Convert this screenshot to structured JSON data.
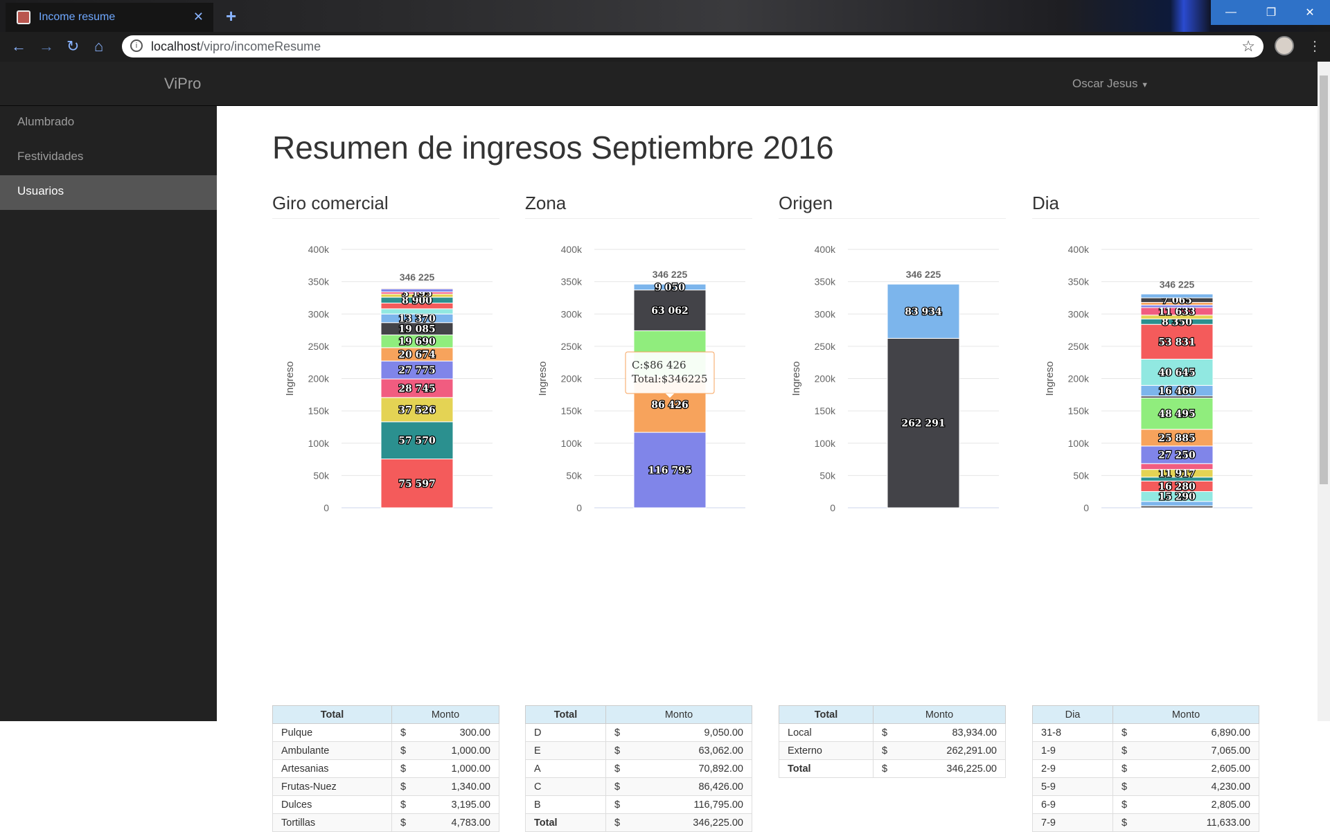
{
  "browser": {
    "tab_title": "Income resume",
    "url_host": "localhost",
    "url_path": "/vipro/incomeResume"
  },
  "app": {
    "brand": "ViPro",
    "user": "Oscar Jesus"
  },
  "sidebar": {
    "items": [
      {
        "label": "Alumbrado"
      },
      {
        "label": "Festividades"
      },
      {
        "label": "Usuarios"
      }
    ]
  },
  "page": {
    "title": "Resumen de ingresos Septiembre 2016"
  },
  "tooltip": {
    "line1": "C:$86 426",
    "line2": "Total:$346225"
  },
  "chart_data": [
    {
      "type": "bar",
      "stacked": true,
      "title": "Giro comercial",
      "ylabel": "Ingreso",
      "ylim": [
        0,
        400000
      ],
      "ticks": [
        "0",
        "50k",
        "100k",
        "150k",
        "200k",
        "250k",
        "300k",
        "350k",
        "400k"
      ],
      "total_label": "346 225",
      "segments": [
        {
          "value": 75597,
          "label": "75 597",
          "color": "#f45b5b"
        },
        {
          "value": 57570,
          "label": "57 570",
          "color": "#2b908f"
        },
        {
          "value": 37526,
          "label": "37 526",
          "color": "#e4d354"
        },
        {
          "value": 28745,
          "label": "28 745",
          "color": "#f15c80"
        },
        {
          "value": 27775,
          "label": "27 775",
          "color": "#8085e9"
        },
        {
          "value": 20674,
          "label": "20 674",
          "color": "#f7a35c"
        },
        {
          "value": 19690,
          "label": "19 690",
          "color": "#90ed7d"
        },
        {
          "value": 19085,
          "label": "19 085",
          "color": "#434348"
        },
        {
          "value": 13370,
          "label": "13 370",
          "color": "#7cb5ec"
        },
        {
          "value": 8000,
          "label": "",
          "color": "#91e8e1"
        },
        {
          "value": 8900,
          "label": "",
          "color": "#f45b5b"
        },
        {
          "value": 9000,
          "label": "8 900",
          "color": "#2b908f"
        },
        {
          "value": 5000,
          "label": "",
          "color": "#e4d354"
        },
        {
          "value": 3195,
          "label": "3 195",
          "color": "#f15c80"
        },
        {
          "value": 4783,
          "label": "",
          "color": "#8085e9"
        },
        {
          "value": 1340,
          "label": "",
          "color": "#f7a35c"
        },
        {
          "value": 1000,
          "label": "",
          "color": "#434348"
        },
        {
          "value": 1000,
          "label": "",
          "color": "#7cb5ec"
        }
      ]
    },
    {
      "type": "bar",
      "stacked": true,
      "title": "Zona",
      "ylabel": "Ingreso",
      "ylim": [
        0,
        400000
      ],
      "ticks": [
        "0",
        "50k",
        "100k",
        "150k",
        "200k",
        "250k",
        "300k",
        "350k",
        "400k"
      ],
      "total_label": "346 225",
      "segments": [
        {
          "value": 116795,
          "label": "116 795",
          "color": "#8085e9"
        },
        {
          "value": 86426,
          "label": "86 426",
          "color": "#f7a35c"
        },
        {
          "value": 70892,
          "label": "",
          "color": "#90ed7d"
        },
        {
          "value": 63062,
          "label": "63 062",
          "color": "#434348"
        },
        {
          "value": 9050,
          "label": "9 050",
          "color": "#7cb5ec"
        }
      ]
    },
    {
      "type": "bar",
      "stacked": true,
      "title": "Origen",
      "ylabel": "Ingreso",
      "ylim": [
        0,
        400000
      ],
      "ticks": [
        "0",
        "50k",
        "100k",
        "150k",
        "200k",
        "250k",
        "300k",
        "350k",
        "400k"
      ],
      "total_label": "346 225",
      "segments": [
        {
          "value": 262291,
          "label": "262 291",
          "color": "#434348"
        },
        {
          "value": 83934,
          "label": "83 934",
          "color": "#7cb5ec"
        }
      ]
    },
    {
      "type": "bar",
      "stacked": true,
      "title": "Dia",
      "ylabel": "Ingreso",
      "ylim": [
        0,
        400000
      ],
      "ticks": [
        "0",
        "50k",
        "100k",
        "150k",
        "200k",
        "250k",
        "300k",
        "350k",
        "400k"
      ],
      "total_label": "346 225",
      "segments": [
        {
          "value": 3000,
          "label": "",
          "color": "#434348"
        },
        {
          "value": 6890,
          "label": "",
          "color": "#7cb5ec"
        },
        {
          "value": 15290,
          "label": "15 290",
          "color": "#91e8e1"
        },
        {
          "value": 16280,
          "label": "16 280",
          "color": "#f45b5b"
        },
        {
          "value": 6000,
          "label": "",
          "color": "#2b908f"
        },
        {
          "value": 11917,
          "label": "11 917",
          "color": "#e4d354"
        },
        {
          "value": 9000,
          "label": "",
          "color": "#f15c80"
        },
        {
          "value": 27250,
          "label": "27 250",
          "color": "#8085e9"
        },
        {
          "value": 25885,
          "label": "25 885",
          "color": "#f7a35c"
        },
        {
          "value": 48495,
          "label": "48 495",
          "color": "#90ed7d"
        },
        {
          "value": 3000,
          "label": "",
          "color": "#434348"
        },
        {
          "value": 16460,
          "label": "16 460",
          "color": "#7cb5ec"
        },
        {
          "value": 40645,
          "label": "40 645",
          "color": "#91e8e1"
        },
        {
          "value": 53831,
          "label": "53 831",
          "color": "#f45b5b"
        },
        {
          "value": 8350,
          "label": "8 350",
          "color": "#2b908f"
        },
        {
          "value": 6000,
          "label": "",
          "color": "#e4d354"
        },
        {
          "value": 11633,
          "label": "11 633",
          "color": "#f15c80"
        },
        {
          "value": 4000,
          "label": "",
          "color": "#8085e9"
        },
        {
          "value": 4000,
          "label": "",
          "color": "#f7a35c"
        },
        {
          "value": 7065,
          "label": "7 065",
          "color": "#434348"
        },
        {
          "value": 6000,
          "label": "",
          "color": "#7cb5ec"
        }
      ]
    }
  ],
  "tables": [
    {
      "headers": [
        "Total",
        "Monto"
      ],
      "rows": [
        [
          "Pulque",
          "$",
          "300.00"
        ],
        [
          "Ambulante",
          "$",
          "1,000.00"
        ],
        [
          "Artesanias",
          "$",
          "1,000.00"
        ],
        [
          "Frutas-Nuez",
          "$",
          "1,340.00"
        ],
        [
          "Dulces",
          "$",
          "3,195.00"
        ],
        [
          "Tortillas",
          "$",
          "4,783.00"
        ]
      ]
    },
    {
      "headers": [
        "Total",
        "Monto"
      ],
      "rows": [
        [
          "D",
          "$",
          "9,050.00"
        ],
        [
          "E",
          "$",
          "63,062.00"
        ],
        [
          "A",
          "$",
          "70,892.00"
        ],
        [
          "C",
          "$",
          "86,426.00"
        ],
        [
          "B",
          "$",
          "116,795.00"
        ],
        [
          "Total",
          "$",
          "346,225.00"
        ]
      ]
    },
    {
      "headers": [
        "Total",
        "Monto"
      ],
      "rows": [
        [
          "Local",
          "$",
          "83,934.00"
        ],
        [
          "Externo",
          "$",
          "262,291.00"
        ],
        [
          "Total",
          "$",
          "346,225.00"
        ]
      ]
    },
    {
      "headers": [
        "Dia",
        "Monto"
      ],
      "rows": [
        [
          "31-8",
          "$",
          "6,890.00"
        ],
        [
          "1-9",
          "$",
          "7,065.00"
        ],
        [
          "2-9",
          "$",
          "2,605.00"
        ],
        [
          "5-9",
          "$",
          "4,230.00"
        ],
        [
          "6-9",
          "$",
          "2,805.00"
        ],
        [
          "7-9",
          "$",
          "11,633.00"
        ]
      ]
    }
  ]
}
